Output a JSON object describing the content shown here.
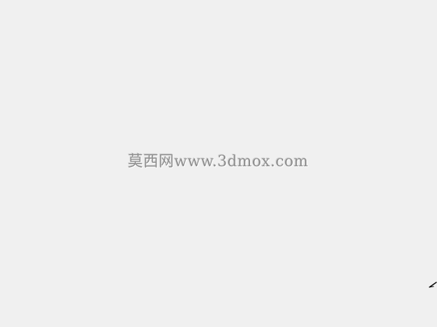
{
  "screen": {
    "background_color": "#f0f0f0"
  },
  "watermark": {
    "text": "莫西网www.3dmox.com",
    "color": "#8f8f8f"
  },
  "cursor": {
    "icon": "cursor-arrow-icon",
    "color": "#000000"
  }
}
